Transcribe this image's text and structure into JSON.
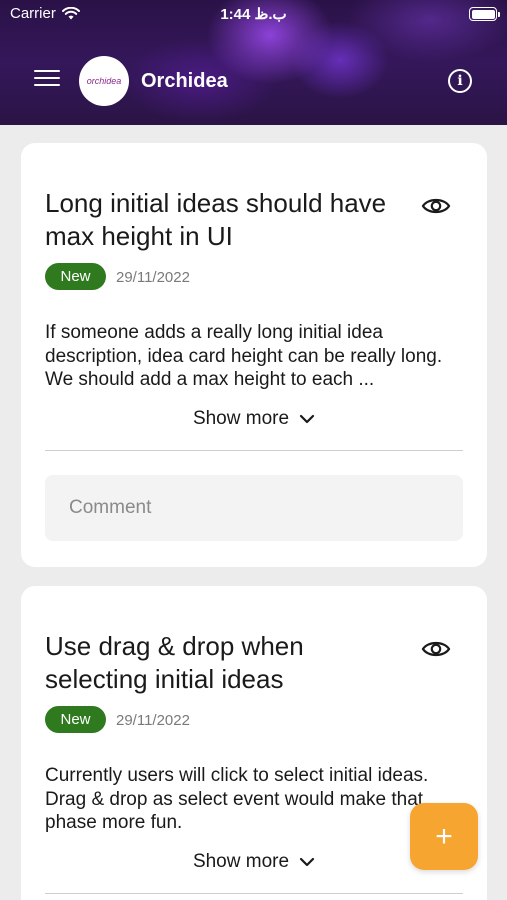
{
  "status_bar": {
    "carrier": "Carrier",
    "time": "ب.ظ 1:44"
  },
  "header": {
    "logo_text": "orchidea",
    "title": "Orchidea"
  },
  "ideas": [
    {
      "title": "Long initial ideas should have max height in UI",
      "badge": "New",
      "date": "29/11/2022",
      "description": "If someone adds a really long initial idea description, idea card height can be really long. We should add a max height to each ...",
      "show_more": "Show more",
      "comment_placeholder": "Comment"
    },
    {
      "title": "Use drag & drop when selecting initial ideas",
      "badge": "New",
      "date": "29/11/2022",
      "description": "Currently users will click to select initial ideas. Drag & drop as select event would make that phase more fun.",
      "show_more": "Show more"
    }
  ],
  "fab": {
    "label": "+"
  },
  "colors": {
    "badge": "#2f7a1f",
    "fab": "#f7a531",
    "header": "#2a1247"
  }
}
